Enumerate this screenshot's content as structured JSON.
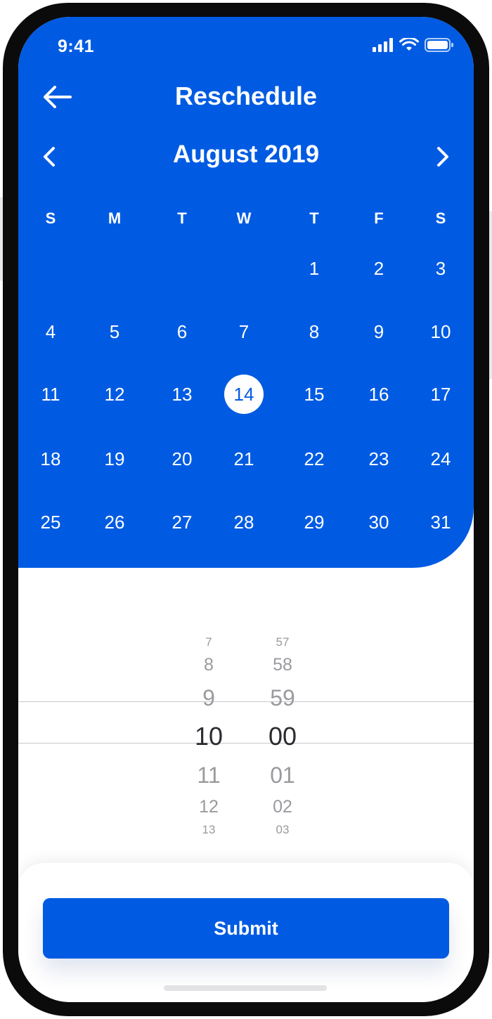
{
  "status_bar": {
    "time": "9:41",
    "icons": [
      "signal-icon",
      "wifi-icon",
      "battery-icon"
    ]
  },
  "header": {
    "title": "Reschedule",
    "back_icon": "arrow-left-icon"
  },
  "calendar": {
    "month_label": "August 2019",
    "prev_icon": "chevron-left-icon",
    "next_icon": "chevron-right-icon",
    "weekdays": [
      "S",
      "M",
      "T",
      "W",
      "T",
      "F",
      "S"
    ],
    "weeks": [
      [
        "",
        "",
        "",
        "",
        "1",
        "2",
        "3"
      ],
      [
        "4",
        "5",
        "6",
        "7",
        "8",
        "9",
        "10"
      ],
      [
        "11",
        "12",
        "13",
        "14",
        "15",
        "16",
        "17"
      ],
      [
        "18",
        "19",
        "20",
        "21",
        "22",
        "23",
        "24"
      ],
      [
        "25",
        "26",
        "27",
        "28",
        "29",
        "30",
        "31"
      ]
    ],
    "selected_day": "14"
  },
  "time_picker": {
    "hours": [
      "7",
      "8",
      "9",
      "10",
      "11",
      "12",
      "13"
    ],
    "minutes": [
      "57",
      "58",
      "59",
      "00",
      "01",
      "02",
      "03"
    ],
    "selected_hour": "10",
    "selected_minute": "00"
  },
  "actions": {
    "submit_label": "Submit"
  },
  "colors": {
    "primary": "#005be2",
    "background": "#ffffff",
    "picker_text": "#2b2b30",
    "picker_faded": "#9a9a9f"
  }
}
